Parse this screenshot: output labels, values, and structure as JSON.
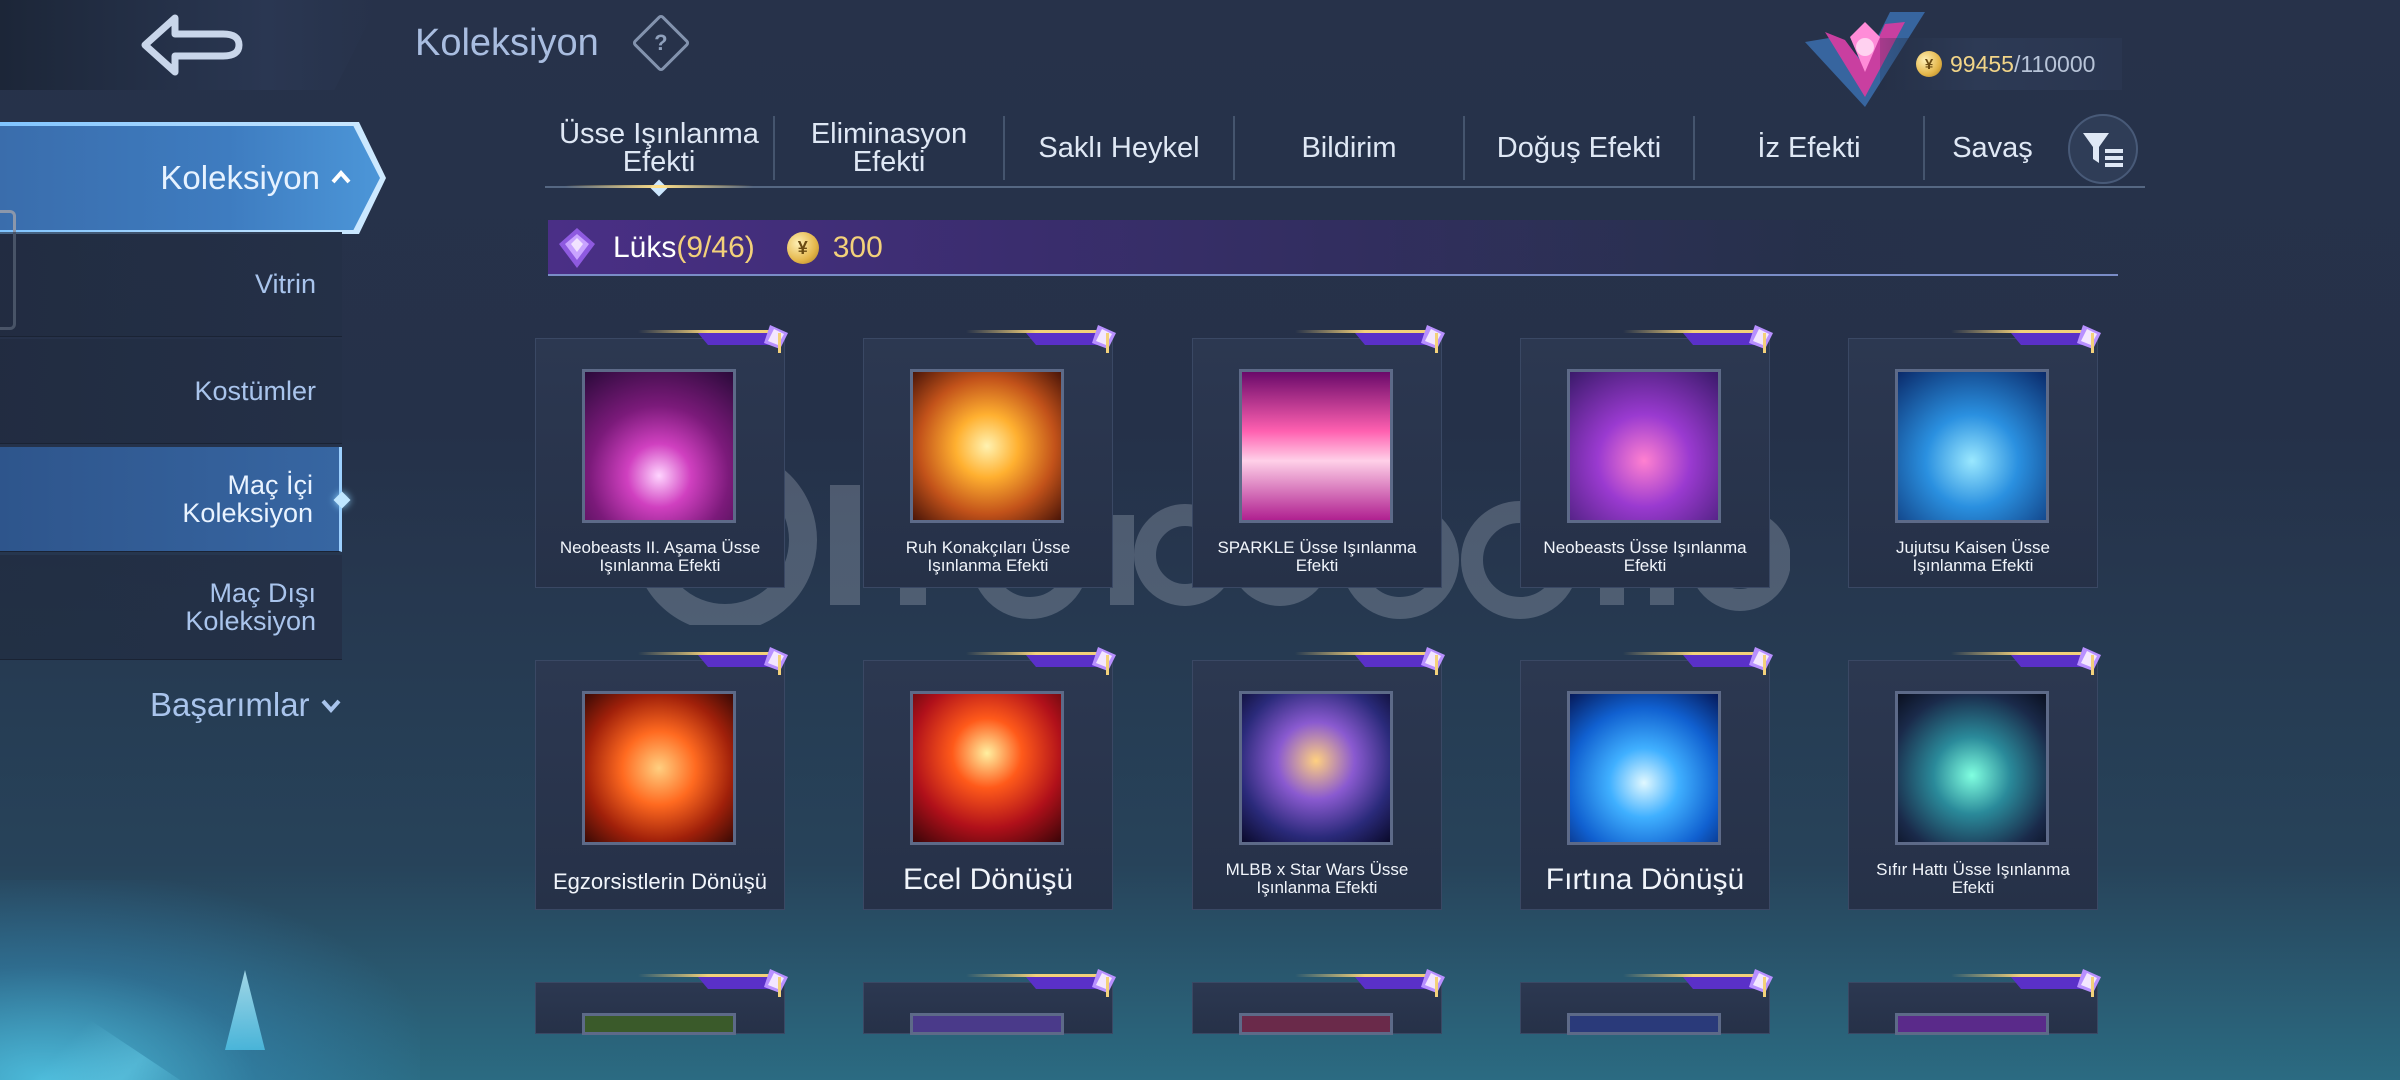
{
  "header": {
    "title": "Koleksiyon",
    "help_icon": "question-diamond-icon",
    "back_icon": "back-arrow-icon",
    "currency": {
      "value": "99455",
      "max": "/110000",
      "icon": "coin-icon"
    }
  },
  "sidebar": {
    "main": {
      "label": "Koleksiyon",
      "icon": "chevron-up-icon"
    },
    "items": [
      {
        "label": "Vitrin"
      },
      {
        "label": "Kostümler"
      },
      {
        "label": "Maç İçi Koleksiyon"
      },
      {
        "label": "Maç Dışı Koleksiyon"
      }
    ],
    "basarimlar": {
      "label": "Başarımlar",
      "icon": "chevron-down-icon"
    }
  },
  "tabs": [
    {
      "label": "Üsse Işınlanma Efekti"
    },
    {
      "label": "Eliminasyon Efekti"
    },
    {
      "label": "Saklı Heykel"
    },
    {
      "label": "Bildirim"
    },
    {
      "label": "Doğuş Efekti"
    },
    {
      "label": "İz Efekti"
    },
    {
      "label": "Savaş"
    }
  ],
  "section": {
    "label": "Lüks",
    "count": "(9/46)",
    "cost": "300"
  },
  "cards": [
    {
      "name": "Neobeasts II. Aşama Üsse Işınlanma Efekti"
    },
    {
      "name": "Ruh Konakçıları Üsse Işınlanma Efekti"
    },
    {
      "name": "SPARKLE Üsse Işınlanma Efekti"
    },
    {
      "name": "Neobeasts Üsse Işınlanma Efekti"
    },
    {
      "name": "Jujutsu Kaisen Üsse Işınlanma Efekti"
    },
    {
      "name": "Egzorsistlerin Dönüşü"
    },
    {
      "name": "Ecel Dönüşü"
    },
    {
      "name": "MLBB x Star Wars Üsse Işınlanma Efekti"
    },
    {
      "name": "Fırtına Dönüşü"
    },
    {
      "name": "Sıfır Hattı Üsse Işınlanma Efekti"
    }
  ],
  "colors": {
    "accent": "#3e7cc0",
    "gold": "#f3d17a",
    "luxury_purple": "#4a2f86"
  }
}
